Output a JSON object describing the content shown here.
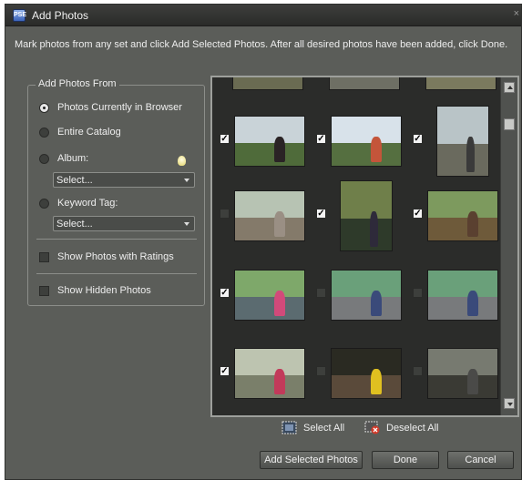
{
  "window": {
    "title": "Add Photos",
    "app_icon_text": "PSE",
    "close_glyph": "×"
  },
  "instructions": "Mark photos from any set and click Add Selected Photos. After all desired photos have been added, click Done.",
  "add_from": {
    "legend": "Add Photos From",
    "options": [
      {
        "label": "Photos Currently in Browser",
        "selected": true
      },
      {
        "label": "Entire Catalog",
        "selected": false
      },
      {
        "label": "Album:",
        "selected": false
      },
      {
        "label": "Keyword Tag:",
        "selected": false
      }
    ],
    "album_select": "Select...",
    "keyword_select": "Select...",
    "show_ratings": "Show Photos with Ratings",
    "show_hidden": "Show Hidden Photos",
    "tip_icon": "lightbulb-icon"
  },
  "gallery": {
    "rows": [
      [
        {
          "checked": true
        },
        {
          "checked": true
        },
        {
          "checked": true
        }
      ],
      [
        {
          "checked": false
        },
        {
          "checked": true
        },
        {
          "checked": true
        }
      ],
      [
        {
          "checked": true
        },
        {
          "checked": false
        },
        {
          "checked": false
        }
      ],
      [
        {
          "checked": true
        },
        {
          "checked": false
        },
        {
          "checked": false
        }
      ]
    ],
    "check_glyph": "✓"
  },
  "selection": {
    "select_all": "Select All",
    "deselect_all": "Deselect All"
  },
  "buttons": {
    "add_selected": "Add Selected Photos",
    "done": "Done",
    "cancel": "Cancel"
  },
  "colors": {
    "dialog_bg": "#5b5d59",
    "gallery_bg": "#2b2c2a",
    "accent_bulb": "#e3d66a"
  }
}
